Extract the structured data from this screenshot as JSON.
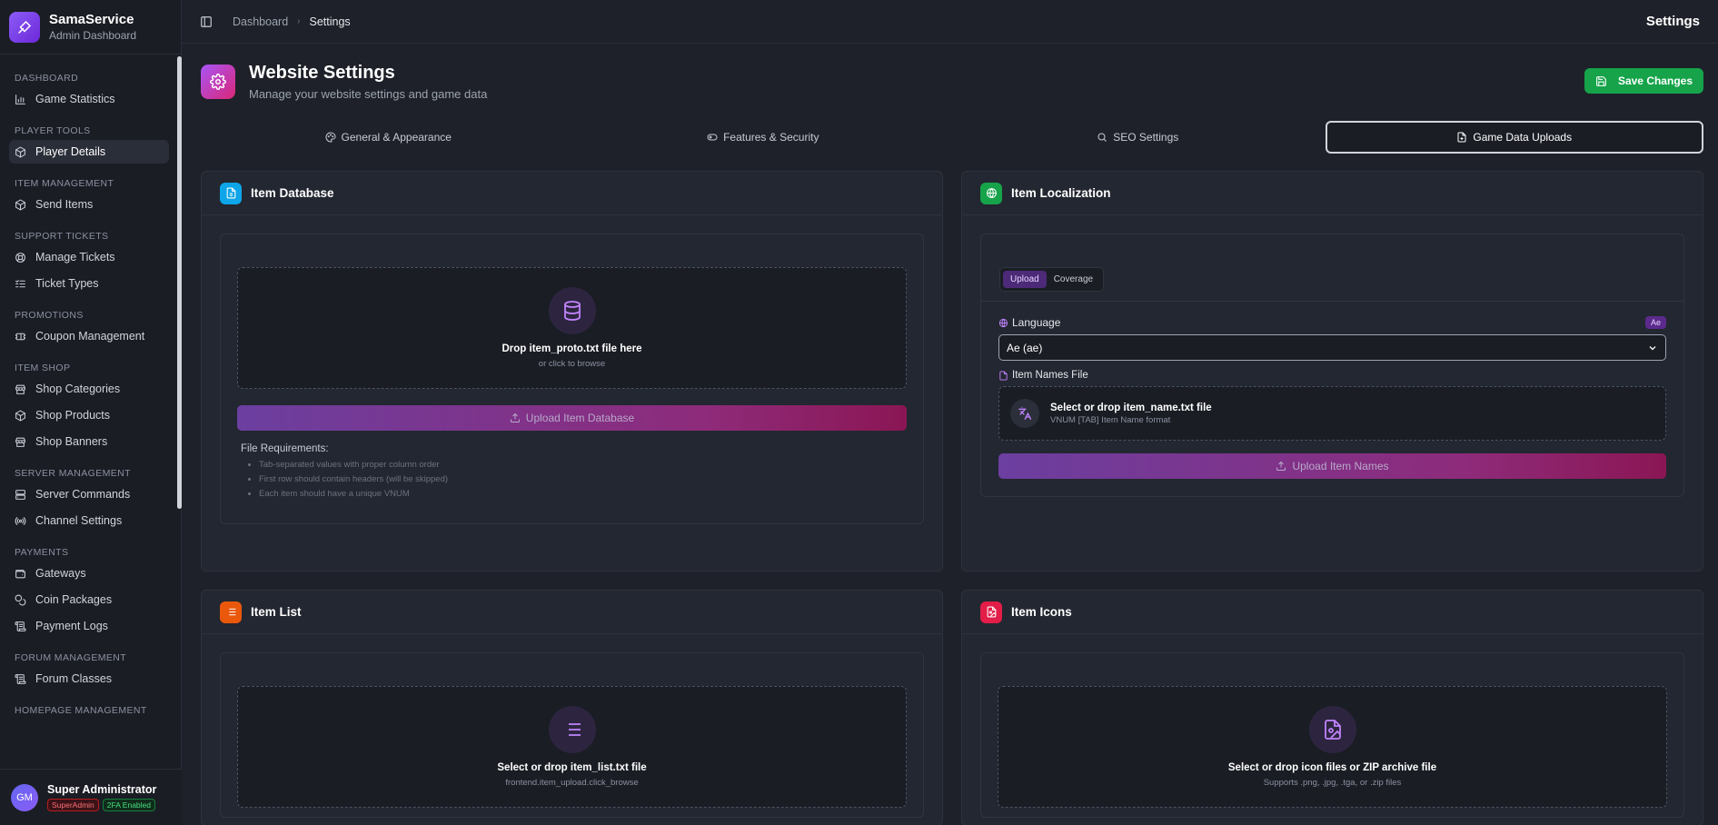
{
  "brand": {
    "title": "SamaService",
    "subtitle": "Admin Dashboard"
  },
  "sidebar": {
    "sections": [
      {
        "label": "DASHBOARD",
        "items": [
          {
            "label": "Game Statistics",
            "icon": "bar-chart-icon"
          }
        ]
      },
      {
        "label": "PLAYER TOOLS",
        "items": [
          {
            "label": "Player Details",
            "icon": "cube-icon",
            "active": true
          }
        ]
      },
      {
        "label": "ITEM MANAGEMENT",
        "items": [
          {
            "label": "Send Items",
            "icon": "cube-icon"
          }
        ]
      },
      {
        "label": "SUPPORT TICKETS",
        "items": [
          {
            "label": "Manage Tickets",
            "icon": "lifebuoy-icon"
          },
          {
            "label": "Ticket Types",
            "icon": "list-check-icon"
          }
        ]
      },
      {
        "label": "PROMOTIONS",
        "items": [
          {
            "label": "Coupon Management",
            "icon": "ticket-icon"
          }
        ]
      },
      {
        "label": "ITEM SHOP",
        "items": [
          {
            "label": "Shop Categories",
            "icon": "store-icon"
          },
          {
            "label": "Shop Products",
            "icon": "cube-icon"
          },
          {
            "label": "Shop Banners",
            "icon": "store-icon"
          }
        ]
      },
      {
        "label": "SERVER MANAGEMENT",
        "items": [
          {
            "label": "Server Commands",
            "icon": "server-icon"
          },
          {
            "label": "Channel Settings",
            "icon": "radio-icon"
          }
        ]
      },
      {
        "label": "PAYMENTS",
        "items": [
          {
            "label": "Gateways",
            "icon": "wallet-icon"
          },
          {
            "label": "Coin Packages",
            "icon": "coins-icon"
          },
          {
            "label": "Payment Logs",
            "icon": "scroll-icon"
          }
        ]
      },
      {
        "label": "FORUM MANAGEMENT",
        "items": [
          {
            "label": "Forum Classes",
            "icon": "scroll-icon"
          }
        ]
      },
      {
        "label": "HOMEPAGE MANAGEMENT",
        "items": []
      }
    ]
  },
  "user": {
    "initials": "GM",
    "name": "Super Administrator",
    "role_badge": "SuperAdmin",
    "twofa_badge": "2FA Enabled"
  },
  "topbar": {
    "breadcrumb": [
      "Dashboard",
      "Settings"
    ],
    "title": "Settings"
  },
  "page": {
    "title": "Website Settings",
    "description": "Manage your website settings and game data",
    "save_label": "Save Changes"
  },
  "tabs": [
    {
      "label": "General & Appearance",
      "icon": "palette-icon"
    },
    {
      "label": "Features & Security",
      "icon": "toggle-icon"
    },
    {
      "label": "SEO Settings",
      "icon": "search-icon"
    },
    {
      "label": "Game Data Uploads",
      "icon": "file-plus-icon",
      "active": true
    }
  ],
  "item_database": {
    "title": "Item Database",
    "drop_title": "Drop item_proto.txt file here",
    "drop_sub": "or click to browse",
    "button": "Upload Item Database",
    "req_title": "File Requirements:",
    "requirements": [
      "Tab-separated values with proper column order",
      "First row should contain headers (will be skipped)",
      "Each item should have a unique VNUM"
    ]
  },
  "item_localization": {
    "title": "Item Localization",
    "seg_upload": "Upload",
    "seg_coverage": "Coverage",
    "language_label": "Language",
    "language_chip": "Ae",
    "language_value": "Ae (ae)",
    "file_label": "Item Names File",
    "file_title": "Select or drop item_name.txt file",
    "file_sub": "VNUM [TAB] Item Name format",
    "button": "Upload Item Names"
  },
  "item_list": {
    "title": "Item List",
    "drop_title": "Select or drop item_list.txt file",
    "drop_sub": "frontend.item_upload.click_browse"
  },
  "item_icons": {
    "title": "Item Icons",
    "drop_title": "Select or drop icon files or ZIP archive file",
    "drop_sub": "Supports .png, .jpg, .tga, or .zip files"
  }
}
